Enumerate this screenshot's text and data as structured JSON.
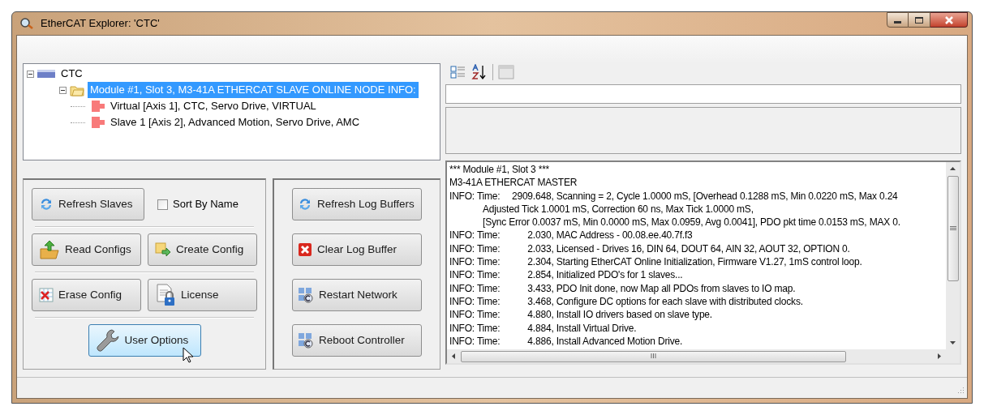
{
  "window": {
    "title": "EtherCAT Explorer: 'CTC'"
  },
  "tree": [
    {
      "label": "CTC",
      "expanded": true,
      "selected": false,
      "children": [
        {
          "label": "Module #1, Slot 3, M3-41A ETHERCAT SLAVE ONLINE NODE INFO:",
          "expanded": true,
          "selected": true,
          "children": [
            {
              "label": "Virtual [Axis 1], CTC, Servo Drive, VIRTUAL",
              "selected": false
            },
            {
              "label": "Slave 1 [Axis 2], Advanced Motion, Servo Drive, AMC",
              "selected": false
            }
          ]
        }
      ]
    }
  ],
  "config_buttons": [
    {
      "label": "Refresh Slaves",
      "hovered": false
    },
    {
      "label": "Read Configs",
      "hovered": false
    },
    {
      "label": "Create Config",
      "hovered": false
    },
    {
      "label": "Erase Config",
      "hovered": false
    },
    {
      "label": "License",
      "hovered": false
    },
    {
      "label": "User Options",
      "hovered": true
    }
  ],
  "sort_checkbox": {
    "label": "Sort By Name",
    "checked": false
  },
  "log_buttons": [
    {
      "label": "Refresh Log Buffers"
    },
    {
      "label": "Clear Log Buffer"
    },
    {
      "label": "Restart Network"
    },
    {
      "label": "Reboot Controller"
    }
  ],
  "log": [
    {
      "kind": "plain",
      "text": "*** Module #1, Slot 3 ***"
    },
    {
      "kind": "plain",
      "text": "M3-41A ETHERCAT MASTER"
    },
    {
      "kind": "entry",
      "prefix": "INFO: Time:",
      "time": "2909.648",
      "text": ", Scanning = 2, Cycle 1.0000 mS, [Overhead 0.1288 mS, Min 0.0220 mS, Max 0.24"
    },
    {
      "kind": "continued",
      "text": "Adjusted Tick 1.0001 mS, Correction 60 ns, Max Tick 1.0000 mS,"
    },
    {
      "kind": "continued",
      "text": "[Sync Error 0.0037 mS, Min 0.0000 mS, Max 0.0959, Avg 0.0041], PDO pkt time 0.0153 mS, MAX 0."
    },
    {
      "kind": "entry",
      "prefix": "INFO: Time:",
      "time": "2.030",
      "text": ", MAC Address - 00.08.ee.40.7f.f3"
    },
    {
      "kind": "entry",
      "prefix": "INFO: Time:",
      "time": "2.033",
      "text": ", Licensed - Drives 16, DIN 64, DOUT 64, AIN 32, AOUT 32, OPTION 0."
    },
    {
      "kind": "entry",
      "prefix": "INFO: Time:",
      "time": "2.304",
      "text": ", Starting EtherCAT Online Initialization, Firmware V1.27, 1mS control loop."
    },
    {
      "kind": "entry",
      "prefix": "INFO: Time:",
      "time": "2.854",
      "text": ", Initialized PDO's for 1 slaves..."
    },
    {
      "kind": "entry",
      "prefix": "INFO: Time:",
      "time": "3.433",
      "text": ", PDO Init done, now Map all PDOs from slaves to IO map."
    },
    {
      "kind": "entry",
      "prefix": "INFO: Time:",
      "time": "3.468",
      "text": ", Configure DC options for each slave with distributed clocks."
    },
    {
      "kind": "entry",
      "prefix": "INFO: Time:",
      "time": "4.880",
      "text": ", Install IO drivers based on slave type."
    },
    {
      "kind": "entry",
      "prefix": "INFO: Time:",
      "time": "4.884",
      "text": ", Install Virtual Drive."
    },
    {
      "kind": "entry",
      "prefix": "INFO: Time:",
      "time": "4.886",
      "text": ", Install Advanced Motion Drive."
    }
  ],
  "scrollbar_grip": "III"
}
